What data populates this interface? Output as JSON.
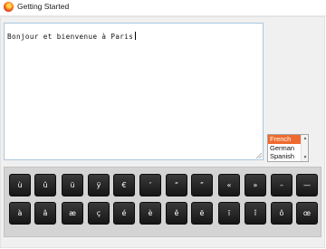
{
  "window": {
    "title": "Getting Started",
    "icon": "firefox-icon"
  },
  "editor": {
    "text": "Bonjour et bienvenue à Paris"
  },
  "language_list": {
    "options": [
      "French",
      "German",
      "Spanish"
    ],
    "selected": "French",
    "selected_color": "#ef6a2e"
  },
  "keyboard": {
    "row1": [
      "ù",
      "û",
      "ü",
      "ÿ",
      "€",
      "’",
      "“",
      "”",
      "«",
      "»",
      "–",
      "—"
    ],
    "row2": [
      "à",
      "â",
      "æ",
      "ç",
      "é",
      "è",
      "ê",
      "ë",
      "ï",
      "î",
      "ô",
      "œ"
    ]
  }
}
